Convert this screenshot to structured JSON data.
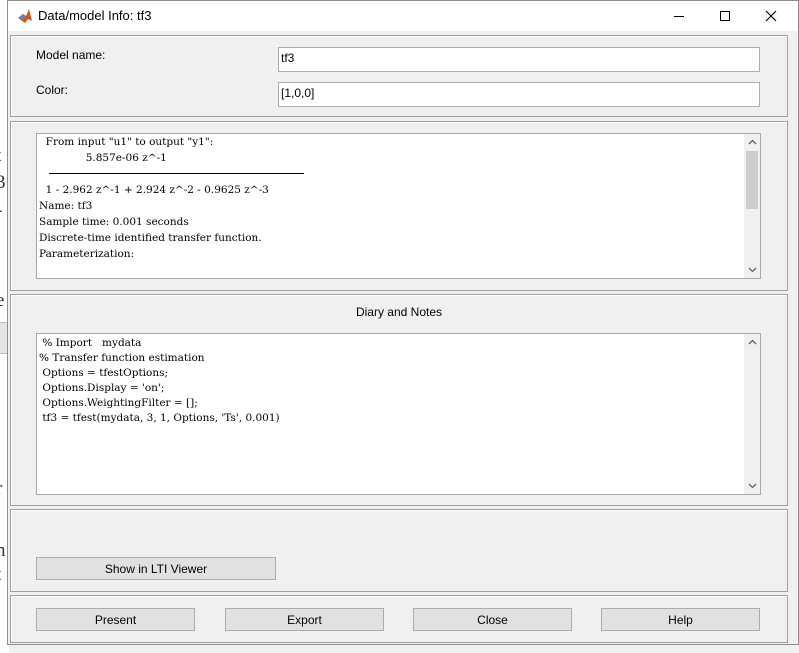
{
  "window": {
    "title": "Data/model Info: tf3"
  },
  "background_fragments": [
    "t",
    "3",
    "-",
    "e",
    "r",
    "n",
    "t"
  ],
  "model": {
    "name_label": "Model name:",
    "name_value": "tf3",
    "color_label": "Color:",
    "color_value": "[1,0,0]"
  },
  "info_text": [
    "  From input \"u1\" to output \"y1\":",
    "              5.857e-06 z^-1",
    "  ---------------------------------------------",
    "  1 - 2.962 z^-1 + 2.924 z^-2 - 0.9625 z^-3",
    "Name: tf3",
    "Sample time: 0.001 seconds",
    "Discrete-time identified transfer function.",
    "",
    "Parameterization:"
  ],
  "diary": {
    "heading": "Diary and Notes",
    "lines": [
      "",
      " % Import   mydata",
      "",
      "% Transfer function estimation",
      " Options = tfestOptions;",
      " Options.Display = 'on';",
      " Options.WeightingFilter = [];",
      "",
      " tf3 = tfest(mydata, 3, 1, Options, 'Ts', 0.001)"
    ]
  },
  "buttons": {
    "show_lti": "Show in LTI Viewer",
    "present": "Present",
    "export": "Export",
    "close": "Close",
    "help": "Help"
  },
  "colors": {
    "titlebar": "#ffffff",
    "panel": "#f0f0f0",
    "button": "#e1e1e1",
    "matlab_icon": "#d95319"
  },
  "icons": [
    "matlab-icon",
    "minimize-icon",
    "maximize-icon",
    "close-icon",
    "scroll-up-icon",
    "scroll-down-icon"
  ]
}
